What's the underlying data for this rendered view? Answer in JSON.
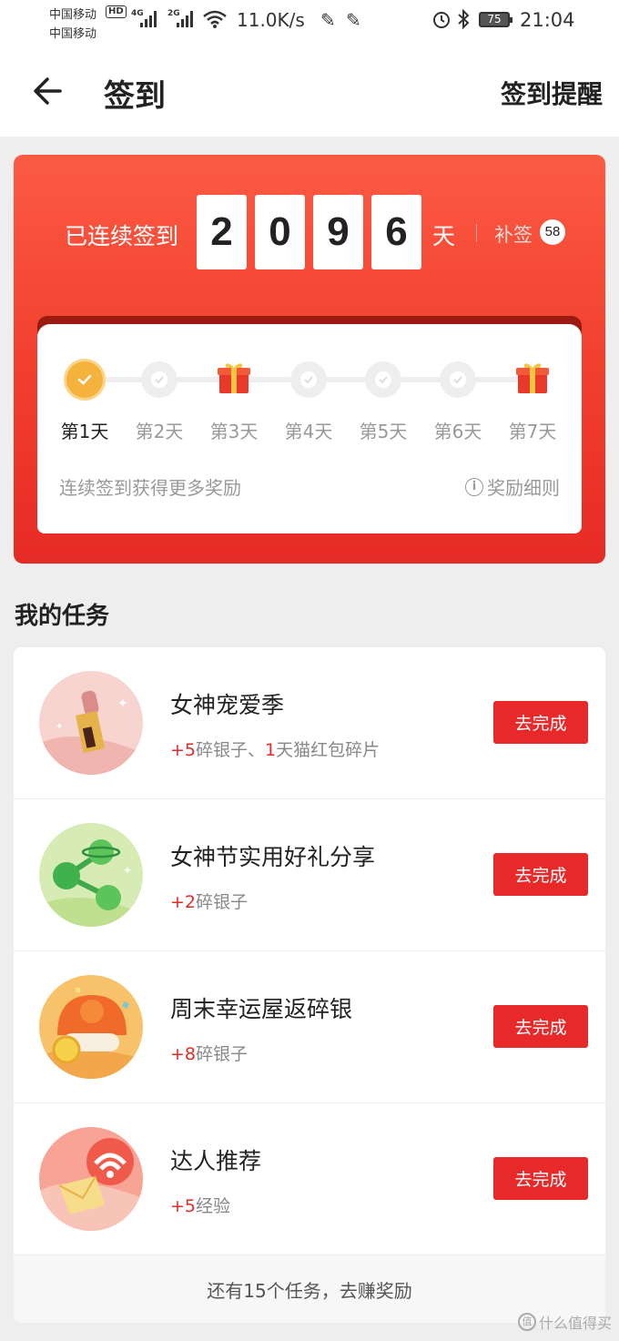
{
  "status_bar": {
    "carrier_1": "中国移动",
    "carrier_2": "中国移动",
    "hd": "HD",
    "net_1": "4G",
    "net_2": "2G",
    "speed": "11.0K/s",
    "battery": "75",
    "time": "21:04"
  },
  "nav": {
    "title": "签到",
    "remind_label": "签到提醒"
  },
  "checkin": {
    "streak_prefix": "已连续签到",
    "digits": [
      "2",
      "0",
      "9",
      "6"
    ],
    "streak_unit": "天",
    "makeup_label": "补签",
    "makeup_count": "58",
    "days": [
      "第1天",
      "第2天",
      "第3天",
      "第4天",
      "第5天",
      "第6天",
      "第7天"
    ],
    "hint": "连续签到获得更多奖励",
    "rules_label": "奖励细则"
  },
  "tasks_section": {
    "title": "我的任务",
    "button_label": "去完成",
    "items": [
      {
        "title": "女神宠爱季",
        "reward_a_num": "+5",
        "reward_a_text": "碎银子、",
        "reward_b_num": "1",
        "reward_b_text": "天猫红包碎片"
      },
      {
        "title": "女神节实用好礼分享",
        "reward_a_num": "+2",
        "reward_a_text": "碎银子"
      },
      {
        "title": "周末幸运屋返碎银",
        "reward_a_num": "+8",
        "reward_a_text": "碎银子"
      },
      {
        "title": "达人推荐",
        "reward_a_num": "+5",
        "reward_a_text": "经验"
      }
    ],
    "more_label": "还有15个任务，去赚奖励"
  },
  "watermark": "值 什么值得买",
  "colors": {
    "accent_red": "#e8292a",
    "checked_gold": "#f5b23c"
  }
}
